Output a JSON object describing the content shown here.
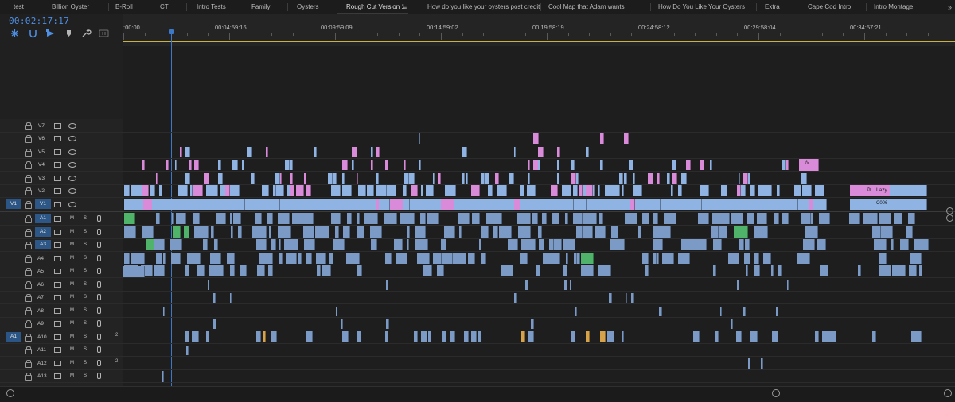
{
  "tabs": [
    {
      "label": "test",
      "active": false
    },
    {
      "label": "Billion Oyster",
      "active": false
    },
    {
      "label": "B-Roll",
      "active": false
    },
    {
      "label": "CT",
      "active": false
    },
    {
      "label": "Intro Tests",
      "active": false
    },
    {
      "label": "Family",
      "active": false
    },
    {
      "label": "Oysters",
      "active": false
    },
    {
      "label": "Rough Cut Version 1",
      "active": true
    },
    {
      "label": "How do you like your oysters post credit",
      "active": false
    },
    {
      "label": "Cool Map that Adam wants",
      "active": false
    },
    {
      "label": "How Do You Like Your Oysters",
      "active": false
    },
    {
      "label": "Extra",
      "active": false
    },
    {
      "label": "Cape Cod Intro",
      "active": false
    },
    {
      "label": "Intro Montage",
      "active": false
    }
  ],
  "tab_menu_symbol": "≡",
  "tab_overflow_symbol": "»",
  "timecode": "00:02:17:17",
  "ruler_labels": [
    ":00:00",
    "00:04:59:16",
    "00:09:59:09",
    "00:14:59:02",
    "00:19:58:19",
    "00:24:58:12",
    "00:29:58:04",
    "00:34:57:21"
  ],
  "tools": [
    "snap-icon",
    "linked-selection-icon",
    "insert-icon",
    "marker-icon",
    "wrench-icon",
    "captions-icon"
  ],
  "video_tracks": [
    {
      "name": "V7",
      "source_patch": "",
      "target": false
    },
    {
      "name": "V6",
      "source_patch": "",
      "target": false
    },
    {
      "name": "V5",
      "source_patch": "",
      "target": false
    },
    {
      "name": "V4",
      "source_patch": "",
      "target": false
    },
    {
      "name": "V3",
      "source_patch": "",
      "target": false
    },
    {
      "name": "V2",
      "source_patch": "",
      "target": false
    },
    {
      "name": "V1",
      "source_patch": "V1",
      "target": true
    }
  ],
  "audio_tracks": [
    {
      "name": "A1",
      "source_patch": "",
      "target": true,
      "channels": ""
    },
    {
      "name": "A2",
      "source_patch": "",
      "target": true,
      "channels": ""
    },
    {
      "name": "A3",
      "source_patch": "",
      "target": true,
      "channels": ""
    },
    {
      "name": "A4",
      "source_patch": "",
      "target": false,
      "channels": ""
    },
    {
      "name": "A5",
      "source_patch": "",
      "target": false,
      "channels": ""
    },
    {
      "name": "A6",
      "source_patch": "",
      "target": false,
      "channels": ""
    },
    {
      "name": "A7",
      "source_patch": "",
      "target": false,
      "channels": ""
    },
    {
      "name": "A8",
      "source_patch": "",
      "target": false,
      "channels": ""
    },
    {
      "name": "A9",
      "source_patch": "",
      "target": false,
      "channels": ""
    },
    {
      "name": "A10",
      "source_patch": "A1",
      "target": false,
      "channels": "2"
    },
    {
      "name": "A11",
      "source_patch": "",
      "target": false,
      "channels": ""
    },
    {
      "name": "A12",
      "source_patch": "",
      "target": false,
      "channels": "2"
    },
    {
      "name": "A13",
      "source_patch": "",
      "target": false,
      "channels": ""
    }
  ],
  "track_button_labels": {
    "mute": "M",
    "solo": "S"
  },
  "clip_labels": {
    "v2_end_clip": "Lazy",
    "v1_end_clip": "C006",
    "fx_badge": "fx"
  },
  "colors": {
    "accent": "#4e8fe6",
    "video_clip": "#8fb3e3",
    "audio_clip": "#7b9bc6",
    "adjustment_clip": "#d98bd9",
    "render_bar": "#c8b245",
    "green_clip": "#4fb36a",
    "orange_clip": "#d6a34a"
  }
}
